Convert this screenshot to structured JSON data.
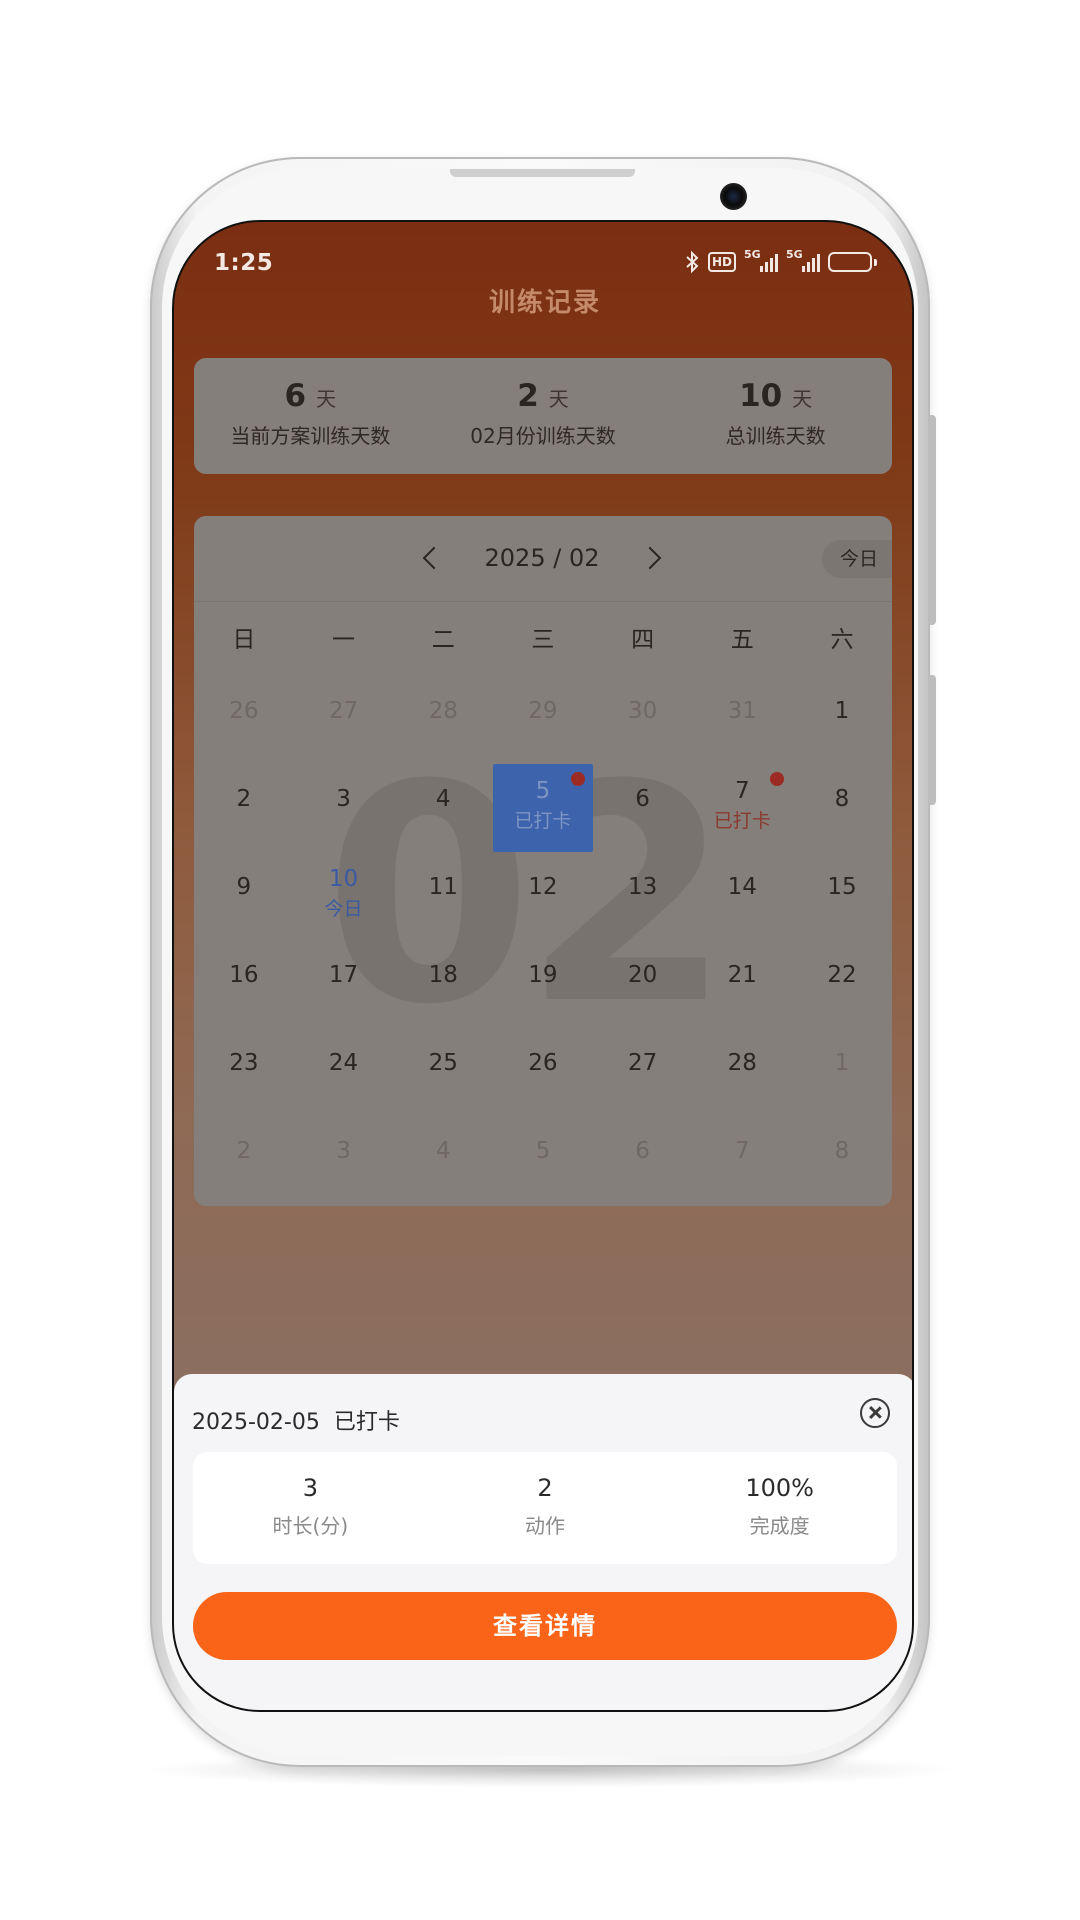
{
  "status_bar": {
    "time": "1:25",
    "hd": "HD",
    "signal_1": "5G",
    "signal_2": "5G"
  },
  "page": {
    "title": "训练记录"
  },
  "summary": [
    {
      "value": "6",
      "unit": "天",
      "label": "当前方案训练天数"
    },
    {
      "value": "2",
      "unit": "天",
      "label": "02月份训练天数"
    },
    {
      "value": "10",
      "unit": "天",
      "label": "总训练天数"
    }
  ],
  "calendar": {
    "month_label": "2025 / 02",
    "today_button": "今日",
    "watermark": "02",
    "weekdays": [
      "日",
      "一",
      "二",
      "三",
      "四",
      "五",
      "六"
    ],
    "weeks": [
      [
        {
          "n": "26",
          "other": true
        },
        {
          "n": "27",
          "other": true
        },
        {
          "n": "28",
          "other": true
        },
        {
          "n": "29",
          "other": true
        },
        {
          "n": "30",
          "other": true
        },
        {
          "n": "31",
          "other": true
        },
        {
          "n": "1"
        }
      ],
      [
        {
          "n": "2"
        },
        {
          "n": "3"
        },
        {
          "n": "4"
        },
        {
          "n": "5",
          "state": "selected",
          "sub": "已打卡",
          "dot": true
        },
        {
          "n": "6"
        },
        {
          "n": "7",
          "state": "checked",
          "sub": "已打卡",
          "dot": true
        },
        {
          "n": "8"
        }
      ],
      [
        {
          "n": "9"
        },
        {
          "n": "10",
          "state": "today",
          "sub": "今日"
        },
        {
          "n": "11"
        },
        {
          "n": "12"
        },
        {
          "n": "13"
        },
        {
          "n": "14"
        },
        {
          "n": "15"
        }
      ],
      [
        {
          "n": "16"
        },
        {
          "n": "17"
        },
        {
          "n": "18"
        },
        {
          "n": "19"
        },
        {
          "n": "20"
        },
        {
          "n": "21"
        },
        {
          "n": "22"
        }
      ],
      [
        {
          "n": "23"
        },
        {
          "n": "24"
        },
        {
          "n": "25"
        },
        {
          "n": "26"
        },
        {
          "n": "27"
        },
        {
          "n": "28"
        },
        {
          "n": "1",
          "other": true
        }
      ],
      [
        {
          "n": "2",
          "other": true
        },
        {
          "n": "3",
          "other": true
        },
        {
          "n": "4",
          "other": true
        },
        {
          "n": "5",
          "other": true
        },
        {
          "n": "6",
          "other": true
        },
        {
          "n": "7",
          "other": true
        },
        {
          "n": "8",
          "other": true
        }
      ]
    ]
  },
  "sheet": {
    "date": "2025-02-05",
    "status": "已打卡",
    "stats": [
      {
        "value": "3",
        "label": "时长(分)"
      },
      {
        "value": "2",
        "label": "动作"
      },
      {
        "value": "100%",
        "label": "完成度"
      }
    ],
    "button_label": "查看详情"
  },
  "colors": {
    "accent": "#fa6419",
    "selected": "#3d63ad",
    "checked_dot": "#9b2b24"
  }
}
